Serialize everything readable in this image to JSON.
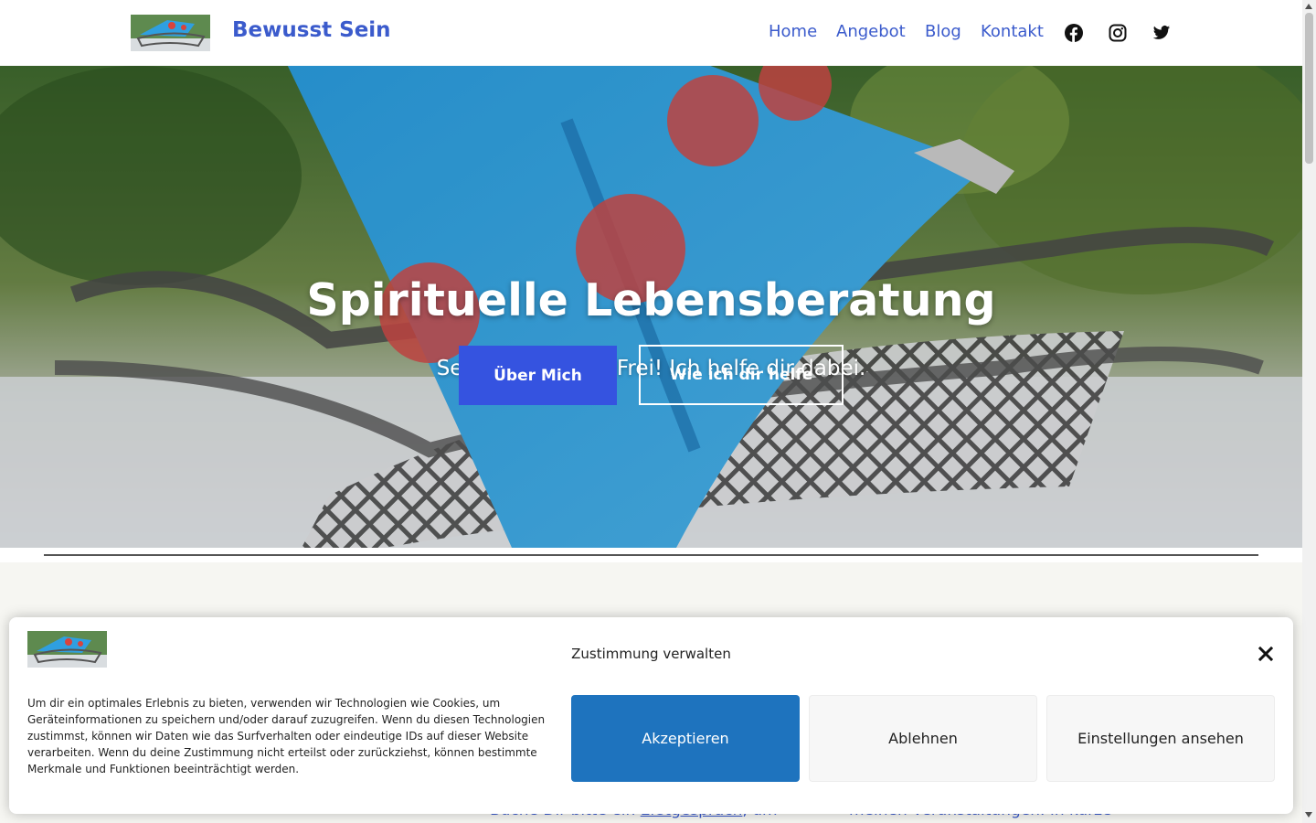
{
  "header": {
    "site_title": "Bewusst Sein",
    "nav": [
      {
        "label": "Home"
      },
      {
        "label": "Angebot"
      },
      {
        "label": "Blog"
      },
      {
        "label": "Kontakt"
      }
    ],
    "social_icons": [
      "facebook-icon",
      "instagram-icon",
      "twitter-icon"
    ],
    "link_color": "#3b5bcc"
  },
  "hero": {
    "title": "Spirituelle Lebensberatung",
    "subtitle": "Sei Bewusst und Frei! Ich helfe dir dabei.",
    "primary_button": "Über Mich",
    "secondary_button": "Wie ich dir helfe",
    "primary_color": "#3553e0"
  },
  "below": {
    "peek_left_prefix": "Buche Dir bitte ein ",
    "peek_left_link": "Erstgespräch",
    "peek_left_suffix": ", um",
    "peek_right": "meinen Veranstaltungen. In kurze"
  },
  "consent": {
    "title": "Zustimmung verwalten",
    "body": "Um dir ein optimales Erlebnis zu bieten, verwenden wir Technologien wie Cookies, um Geräteinformationen zu speichern und/oder darauf zuzugreifen. Wenn du diesen Technologien zustimmst, können wir Daten wie das Surfverhalten oder eindeutige IDs auf dieser Website verarbeiten. Wenn du deine Zustimmung nicht erteilst oder zurückziehst, können bestimmte Merkmale und Funktionen beeinträchtigt werden.",
    "accept": "Akzeptieren",
    "deny": "Ablehnen",
    "preferences": "Einstellungen ansehen",
    "accept_color": "#1e73be"
  }
}
